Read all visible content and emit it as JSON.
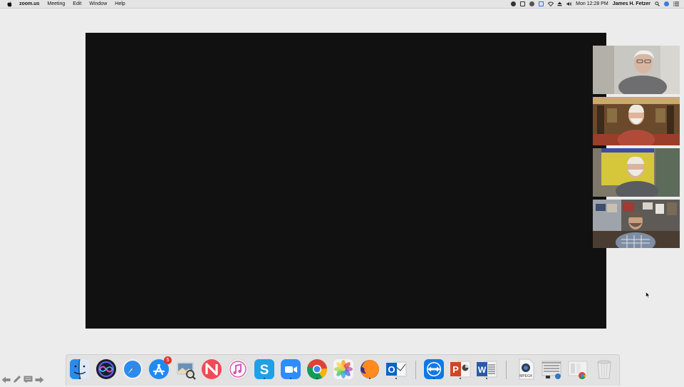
{
  "menubar": {
    "apple_icon": "apple-logo-icon",
    "app_name": "zoom.us",
    "menus": [
      "Meeting",
      "Edit",
      "Window",
      "Help"
    ],
    "clock": "Mon 12:28 PM",
    "user": "James H. Fetzer"
  },
  "participants": [
    {
      "icon": "participant-video-1"
    },
    {
      "icon": "participant-video-2"
    },
    {
      "icon": "participant-video-3"
    },
    {
      "icon": "participant-video-4"
    }
  ],
  "dock": {
    "app_store_badge": "5",
    "apps": [
      "Finder",
      "Siri",
      "Safari",
      "App Store",
      "Preview",
      "News",
      "iTunes",
      "Skype",
      "Zoom",
      "Chrome",
      "Photos",
      "Firefox",
      "Outlook",
      "TeamViewer",
      "PowerPoint",
      "Word",
      "MPEG4 file",
      "Documents",
      "Downloads",
      "Trash"
    ],
    "mpeg_label": "MPEG4"
  }
}
